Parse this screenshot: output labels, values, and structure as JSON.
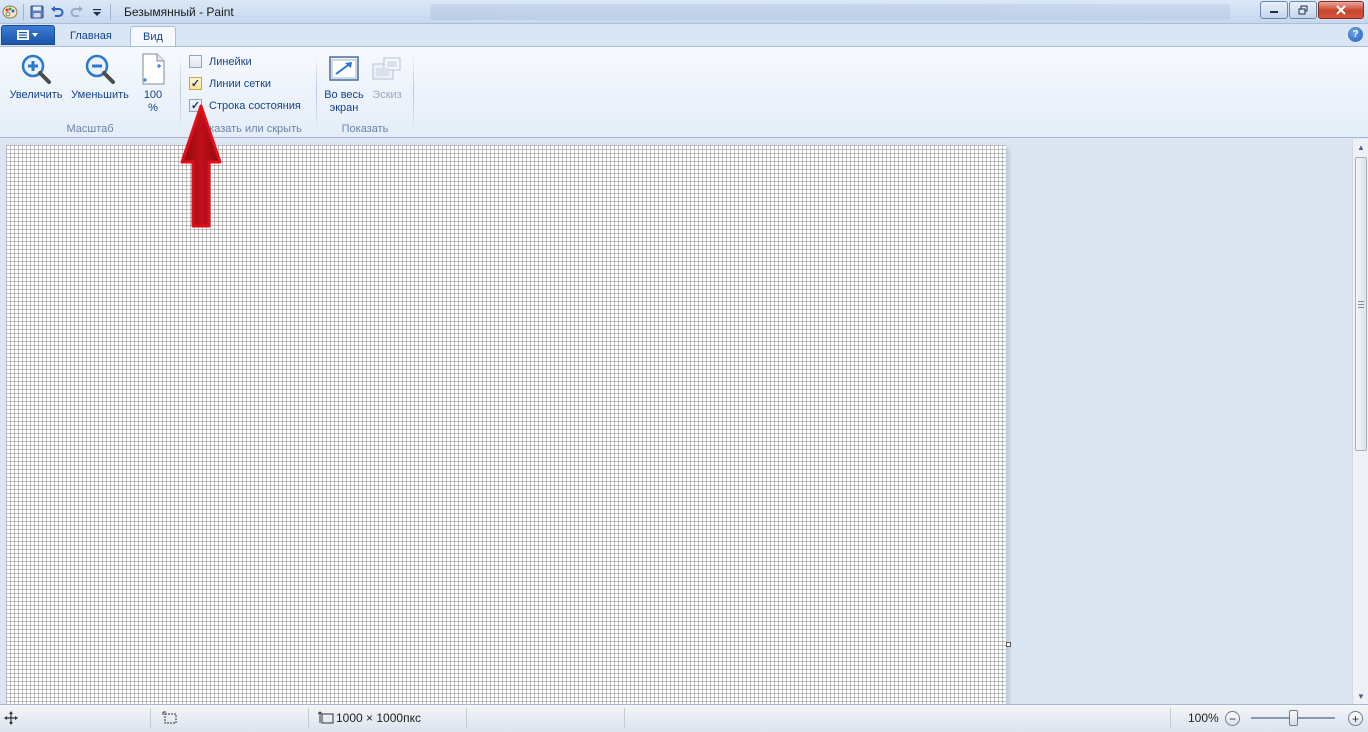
{
  "window": {
    "title": "Безымянный - Paint",
    "buttons": {
      "minimize": "–",
      "maximize": "□",
      "close": "✕"
    }
  },
  "tabs": [
    {
      "label": "Главная",
      "active": false
    },
    {
      "label": "Вид",
      "active": true
    }
  ],
  "ribbon": {
    "zoom_group": {
      "label": "Масштаб",
      "zoom_in": "Увеличить",
      "zoom_out": "Уменьшить",
      "percent_top": "100",
      "percent_bottom": "%"
    },
    "show_group": {
      "label": "Показать или скрыть",
      "rulers": {
        "label": "Линейки",
        "checked": false
      },
      "gridlines": {
        "label": "Линии сетки",
        "checked": true
      },
      "statusbar": {
        "label": "Строка состояния",
        "checked": true
      }
    },
    "display_group": {
      "label": "Показать",
      "fullscreen_top": "Во весь",
      "fullscreen_bottom": "экран",
      "thumbnail": "Эскиз"
    }
  },
  "status": {
    "image_size": "1000 × 1000пкс",
    "zoom": "100%",
    "zoom_level": 1.0
  },
  "colors": {
    "accent": "#15428b",
    "arrow": "#e0101a",
    "arrow_dark": "#8b0a12"
  }
}
